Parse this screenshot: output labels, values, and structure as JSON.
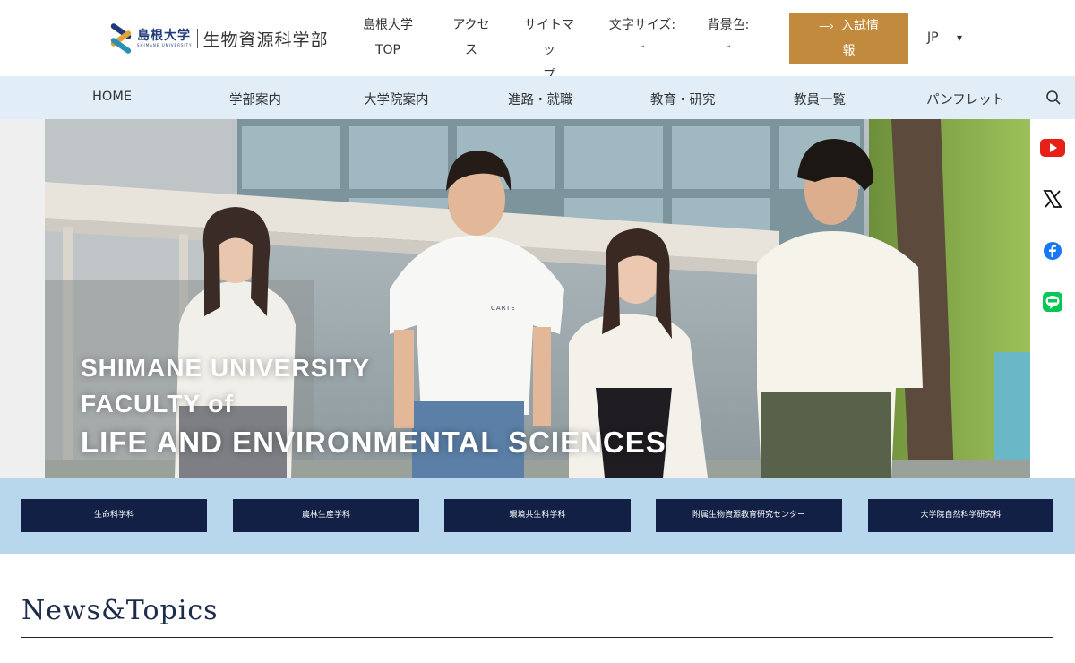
{
  "header": {
    "logo_university": "島根大学",
    "logo_university_en": "SHIMANE UNIVERSITY",
    "logo_faculty": "生物資源科学部",
    "nav": [
      {
        "line1": "島根大学",
        "line2": "TOP"
      },
      {
        "line1": "アクセ",
        "line2": "ス"
      },
      {
        "line1": "サイトマッ",
        "line2": "プ"
      },
      {
        "line1": "文字サイズ:",
        "line2": "⌄"
      },
      {
        "line1": "背景色:",
        "line2": "⌄"
      }
    ],
    "exam_button": {
      "line1": "入試情",
      "line2": "報"
    },
    "language": "JP"
  },
  "main_nav": [
    "HOME",
    "学部案内",
    "大学院案内",
    "進路・就職",
    "教育・研究",
    "教員一覧",
    "パンフレット"
  ],
  "hero": {
    "line1": "SHIMANE UNIVERSITY",
    "line2": "FACULTY of",
    "line3": "LIFE AND ENVIRONMENTAL SCIENCES",
    "tshirt_print": "CARTE"
  },
  "social": [
    "youtube-icon",
    "x-icon",
    "facebook-icon",
    "line-icon"
  ],
  "departments": [
    "生命科学科",
    "農林生産学科",
    "環境共生科学科",
    "附属生物資源教育研究センター",
    "大学院自然科学研究科"
  ],
  "news": {
    "title": "News&Topics"
  },
  "colors": {
    "navy": "#132045",
    "gold": "#c28a3c",
    "nav_bg": "#e1eef8",
    "band_bg": "#b8d6ec"
  }
}
